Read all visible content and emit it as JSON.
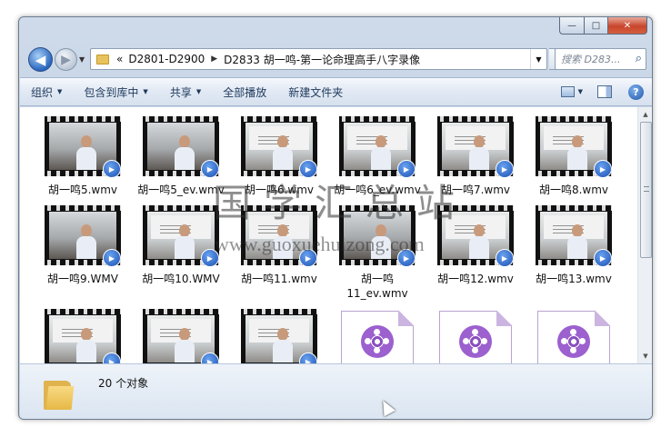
{
  "window": {
    "caption_buttons": {
      "minimize": "—",
      "maximize": "□",
      "close": "✕"
    }
  },
  "nav": {
    "back_glyph": "◀",
    "forward_glyph": "▶",
    "history_glyph": "▼",
    "address": {
      "overflow": "«",
      "segments": [
        "D2801-D2900",
        "D2833 胡一鸣-第一论命理高手八字录像"
      ],
      "separator": "▶",
      "dropdown": "▼"
    },
    "refresh_glyph": "↻",
    "search": {
      "placeholder": "搜索 D283...",
      "icon": "search-icon"
    }
  },
  "toolbar": {
    "organize": "组织",
    "include_library": "包含到库中",
    "share": "共享",
    "play_all": "全部播放",
    "new_folder": "新建文件夹",
    "arrow": "▼",
    "help": "?"
  },
  "files": [
    {
      "name": "胡一鸣5.wmv",
      "kind": "video",
      "scene": "man"
    },
    {
      "name": "胡一鸣5_ev.wmv",
      "kind": "video",
      "scene": "man"
    },
    {
      "name": "胡一鸣6.wmv",
      "kind": "video",
      "scene": "board"
    },
    {
      "name": "胡一鸣6_ev.wmv",
      "kind": "video",
      "scene": "board"
    },
    {
      "name": "胡一鸣7.wmv",
      "kind": "video",
      "scene": "board"
    },
    {
      "name": "胡一鸣8.wmv",
      "kind": "video",
      "scene": "board"
    },
    {
      "name": "胡一鸣9.WMV",
      "kind": "video",
      "scene": "man"
    },
    {
      "name": "胡一鸣10.WMV",
      "kind": "video",
      "scene": "board"
    },
    {
      "name": "胡一鸣11.wmv",
      "kind": "video",
      "scene": "board"
    },
    {
      "name": "胡一鸣",
      "name2": "11_ev.wmv",
      "kind": "video",
      "scene": "man"
    },
    {
      "name": "胡一鸣12.wmv",
      "kind": "video",
      "scene": "board"
    },
    {
      "name": "胡一鸣13.wmv",
      "kind": "video",
      "scene": "board"
    },
    {
      "name": "",
      "kind": "video",
      "scene": "board"
    },
    {
      "name": "",
      "kind": "video",
      "scene": "board"
    },
    {
      "name": "",
      "kind": "video",
      "scene": "board"
    },
    {
      "name": "",
      "kind": "document"
    },
    {
      "name": "",
      "kind": "document"
    },
    {
      "name": "",
      "kind": "document"
    }
  ],
  "status": {
    "count_text": "20 个对象"
  },
  "watermark": {
    "title": "国学汇总站",
    "url": "www.guoxuehuizong.com"
  },
  "colors": {
    "accent": "#1e395b",
    "badge": "#1a4fb3",
    "doc_reel": "#8a4fc0"
  }
}
